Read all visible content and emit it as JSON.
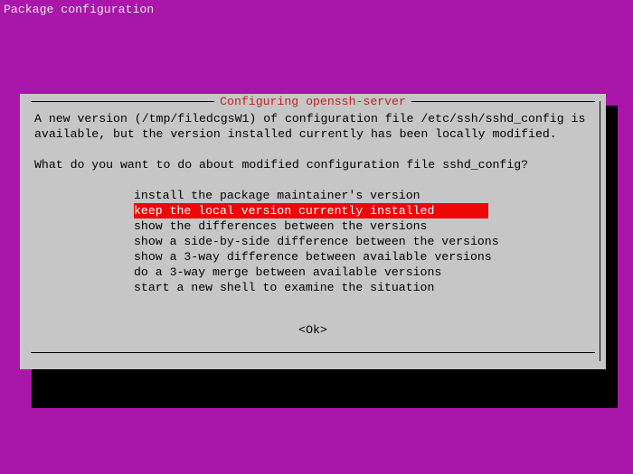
{
  "screen_title": "Package configuration",
  "dialog": {
    "title": "Configuring openssh-server",
    "message_line1": "A new version (/tmp/filedcgsW1) of configuration file /etc/ssh/sshd_config is",
    "message_line2": "available, but the version installed currently has been locally modified.",
    "question": "What do you want to do about modified configuration file sshd_config?",
    "options": [
      "install the package maintainer's version",
      "keep the local version currently installed",
      "show the differences between the versions",
      "show a side-by-side difference between the versions",
      "show a 3-way difference between available versions",
      "do a 3-way merge between available versions",
      "start a new shell to examine the situation"
    ],
    "selected_index": 1,
    "ok_label": "<Ok>"
  },
  "colors": {
    "background": "#a916a9",
    "dialog_bg": "#c6c6c6",
    "title_fg": "#c22020",
    "highlight_bg": "#ef0606",
    "highlight_fg": "#ffffff"
  }
}
